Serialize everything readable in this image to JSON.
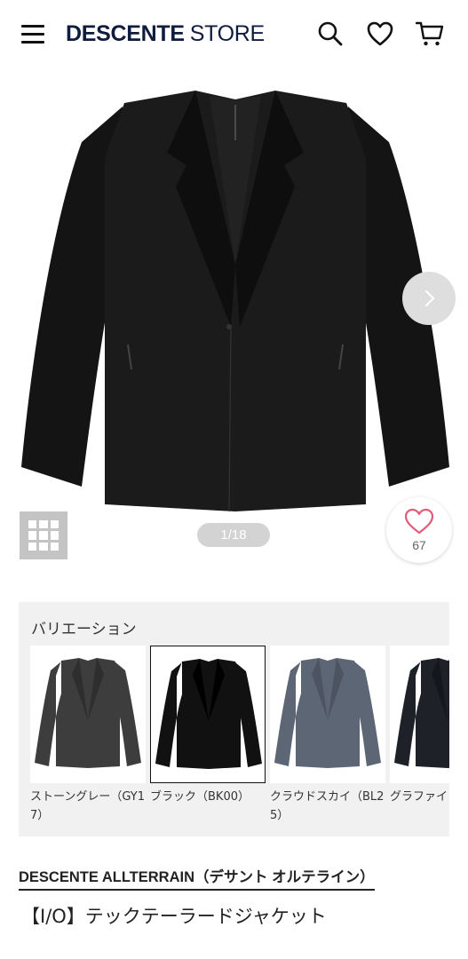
{
  "header": {
    "brand": "DESCENTE",
    "store": "STORE",
    "icons": [
      "menu-icon",
      "search-icon",
      "heart-icon",
      "cart-icon"
    ]
  },
  "gallery": {
    "counter": "1/18",
    "favorite_count": "67",
    "colors": {
      "favorite": "#e05a7a",
      "nav_button": "#dedede"
    }
  },
  "variation": {
    "title": "バリエーション",
    "items": [
      {
        "label": "ストーングレー（GY17）",
        "color": "#3d3d3d",
        "selected": false
      },
      {
        "label": "ブラック（BK00）",
        "color": "#111111",
        "selected": true
      },
      {
        "label": "クラウドスカイ（BL25）",
        "color": "#5d6675",
        "selected": false
      },
      {
        "label": "グラファイト（NVC",
        "color": "#1e2127",
        "selected": false
      }
    ]
  },
  "product": {
    "brand_line": "DESCENTE ALLTERRAIN（デサント オルテライン）",
    "name": "【I/O】テックテーラードジャケット"
  }
}
